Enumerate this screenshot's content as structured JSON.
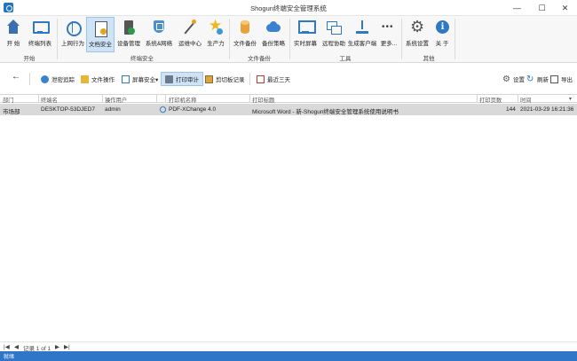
{
  "window": {
    "title": "Shogun终端安全管理系统",
    "controls": [
      "—",
      "☐",
      "✕"
    ]
  },
  "ribbon": {
    "buttons": [
      {
        "label": "开 始",
        "icon": "home-icon"
      },
      {
        "label": "终端列表",
        "icon": "monitor-icon"
      },
      {
        "label": "上网行为",
        "icon": "globe-icon"
      },
      {
        "label": "文档安全",
        "icon": "document-icon",
        "active": true
      },
      {
        "label": "设备管理",
        "icon": "device-icon"
      },
      {
        "label": "系统&网络",
        "icon": "shield-icon"
      },
      {
        "label": "运维中心",
        "icon": "wand-icon"
      },
      {
        "label": "生产力",
        "icon": "star-icon"
      },
      {
        "label": "文件备份",
        "icon": "database-icon"
      },
      {
        "label": "备份策略",
        "icon": "cloud-icon"
      },
      {
        "label": "实时屏幕",
        "icon": "screen-icon"
      },
      {
        "label": "远程协助",
        "icon": "remote-icon"
      },
      {
        "label": "生成客户端",
        "icon": "download-icon"
      },
      {
        "label": "更多...",
        "icon": "more-icon"
      },
      {
        "label": "系统设置",
        "icon": "gear-icon"
      },
      {
        "label": "关 于",
        "icon": "info-icon"
      }
    ],
    "groups": [
      "开始",
      "终端安全",
      "文件备份",
      "工具",
      "其他"
    ]
  },
  "toolbar": {
    "buttons": [
      {
        "label": "泄密追踪",
        "icon": "trace-icon"
      },
      {
        "label": "文件操作",
        "icon": "folder-icon"
      },
      {
        "label": "屏幕安全▾",
        "icon": "screen-security-icon"
      },
      {
        "label": "打印审计",
        "icon": "printer-icon",
        "active": true
      },
      {
        "label": "剪切板记录",
        "icon": "clipboard-icon"
      },
      {
        "label": "最近三天",
        "icon": "calendar-icon"
      }
    ],
    "right": [
      {
        "label": "设置",
        "icon": "settings-icon"
      },
      {
        "label": "刷新",
        "icon": "refresh-icon"
      },
      {
        "label": "导出",
        "icon": "export-icon"
      }
    ],
    "back": "←"
  },
  "table": {
    "columns": [
      "部门",
      "终端名",
      "操作用户",
      "打印机名称",
      "打印标题",
      "打印页数",
      "时间"
    ],
    "rows": [
      {
        "dept": "市场部",
        "terminal": "DESKTOP-53DJED7",
        "user": "admin",
        "printer": "PDF-XChange 4.0",
        "title": "Microsoft Word - 新-Shogun终端安全管理系统使用说明书",
        "pages": "144",
        "time": "2021-03-29 16:21:36"
      }
    ]
  },
  "pager": {
    "first": "|◀",
    "prev": "◀",
    "record": "记录 1 of 1",
    "next": "▶",
    "last": "▶|"
  },
  "status": {
    "text": "就绪"
  },
  "colors": {
    "accent": "#2f75c8",
    "selected_row": "#d9d9d9",
    "active_button": "#cfe3f7"
  }
}
